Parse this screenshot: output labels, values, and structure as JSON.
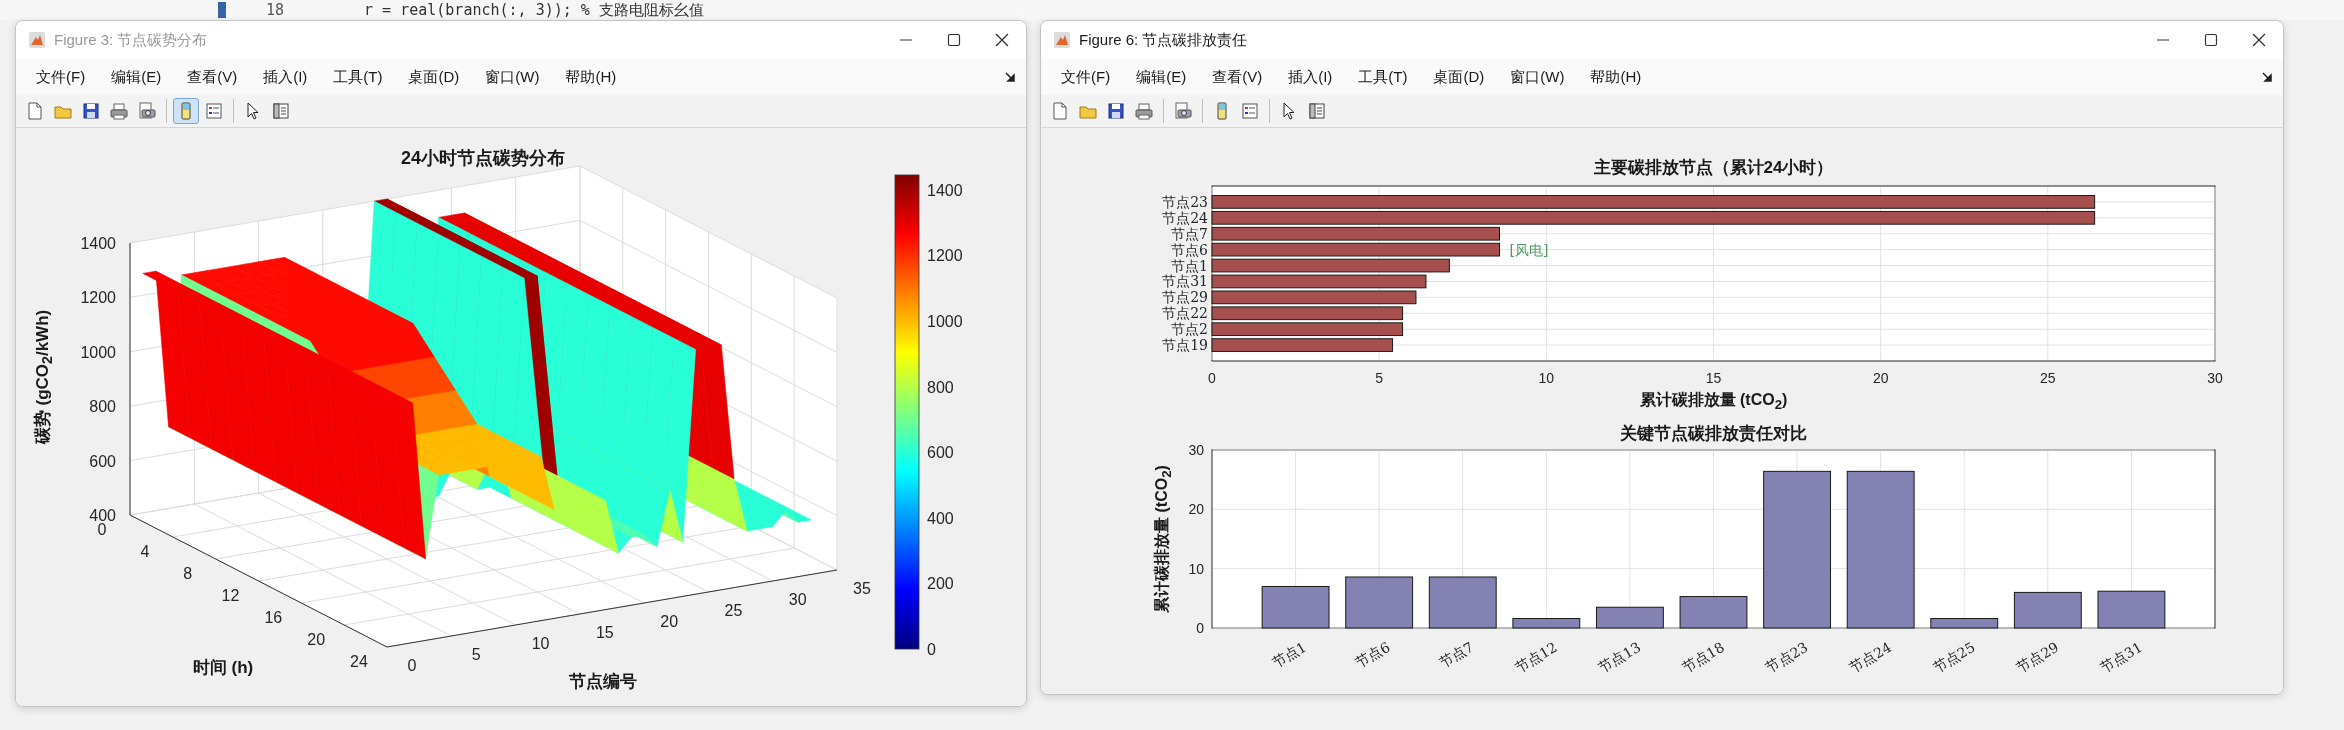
{
  "editor_line": {
    "line_number": "18",
    "code": "r = real(branch(:, 3));  % 支路电阻标幺值"
  },
  "windows": [
    {
      "title": "Figure 3: 节点碳势分布",
      "active": false,
      "menu": [
        "文件(F)",
        "编辑(E)",
        "查看(V)",
        "插入(I)",
        "工具(T)",
        "桌面(D)",
        "窗口(W)",
        "帮助(H)"
      ],
      "toolbar": [
        [
          {
            "kind": "new",
            "selected": false
          },
          {
            "kind": "open",
            "selected": false
          },
          {
            "kind": "save",
            "selected": false
          },
          {
            "kind": "print",
            "selected": false
          },
          {
            "kind": "preview",
            "selected": false
          }
        ],
        [
          {
            "kind": "colorbar",
            "selected": true
          },
          {
            "kind": "legend",
            "selected": false
          }
        ],
        [
          {
            "kind": "pointer",
            "selected": false
          },
          {
            "kind": "inspector",
            "selected": false
          }
        ]
      ],
      "figure": {
        "kind": "surface3d",
        "title": "24小时节点碳势分布",
        "zlabel": "碳势 (gCO$_{2}$/kWh)",
        "ylabel": "时间 (h)",
        "xlabel": "节点编号",
        "zticks": [
          "1400",
          "1200",
          "1000",
          "800",
          "600",
          "400"
        ],
        "yticks": [
          "0",
          "4",
          "8",
          "12",
          "16",
          "20",
          "24"
        ],
        "xticks": [
          "0",
          "5",
          "10",
          "15",
          "20",
          "25",
          "30",
          "35"
        ],
        "colorbar_ticks": [
          "1400",
          "1200",
          "1000",
          "800",
          "600",
          "400",
          "200",
          "0"
        ]
      }
    },
    {
      "title": "Figure 6: 节点碳排放责任",
      "active": true,
      "menu": [
        "文件(F)",
        "编辑(E)",
        "查看(V)",
        "插入(I)",
        "工具(T)",
        "桌面(D)",
        "窗口(W)",
        "帮助(H)"
      ],
      "toolbar": [
        [
          {
            "kind": "new",
            "selected": false
          },
          {
            "kind": "open",
            "selected": false
          },
          {
            "kind": "save",
            "selected": false
          },
          {
            "kind": "print",
            "selected": false
          }
        ],
        [
          {
            "kind": "preview",
            "selected": false
          }
        ],
        [
          {
            "kind": "colorbar",
            "selected": false
          },
          {
            "kind": "legend",
            "selected": false
          }
        ],
        [
          {
            "kind": "pointer",
            "selected": false
          },
          {
            "kind": "inspector",
            "selected": false
          }
        ]
      ],
      "figure": {
        "kind": "bars",
        "charts": [
          {
            "chart_data": {
              "type": "bar",
              "orientation": "horizontal",
              "title": "主要碳排放节点（累计24小时）",
              "xlabel": "累计碳排放量 (tCO$_{2}$)",
              "categories": [
                "节点23",
                "节点24",
                "节点7",
                "节点6",
                "节点1",
                "节点31",
                "节点29",
                "节点22",
                "节点2",
                "节点19"
              ],
              "values": [
                26.4,
                26.4,
                8.6,
                8.6,
                7.1,
                6.4,
                6.1,
                5.7,
                5.7,
                5.4
              ],
              "xlim": [
                0,
                30
              ],
              "xticks": [
                {
                  "value": 0,
                  "label": "0"
                },
                {
                  "value": 5,
                  "label": "5"
                },
                {
                  "value": 10,
                  "label": "10"
                },
                {
                  "value": 15,
                  "label": "15"
                },
                {
                  "value": 20,
                  "label": "20"
                },
                {
                  "value": 25,
                  "label": "25"
                },
                {
                  "value": 30,
                  "label": "30"
                }
              ],
              "grid": true,
              "annotations": [
                {
                  "text": "[风电]",
                  "x": 8.6,
                  "y": "节点6"
                }
              ]
            }
          },
          {
            "chart_data": {
              "type": "bar",
              "orientation": "vertical",
              "title": "关键节点碳排放责任对比",
              "ylabel": "累计碳排放量 (tCO$_{2}$)",
              "categories": [
                "节点1",
                "节点6",
                "节点7",
                "节点12",
                "节点13",
                "节点18",
                "节点23",
                "节点24",
                "节点25",
                "节点29",
                "节点31"
              ],
              "values": [
                7.0,
                8.6,
                8.6,
                1.6,
                3.5,
                5.3,
                26.4,
                26.4,
                1.6,
                6.0,
                6.2
              ],
              "ylim": [
                0,
                30
              ],
              "yticks": [
                {
                  "value": 0,
                  "label": "0"
                },
                {
                  "value": 10,
                  "label": "10"
                },
                {
                  "value": 20,
                  "label": "20"
                },
                {
                  "value": 30,
                  "label": "30"
                }
              ],
              "grid": true
            }
          }
        ]
      }
    }
  ]
}
